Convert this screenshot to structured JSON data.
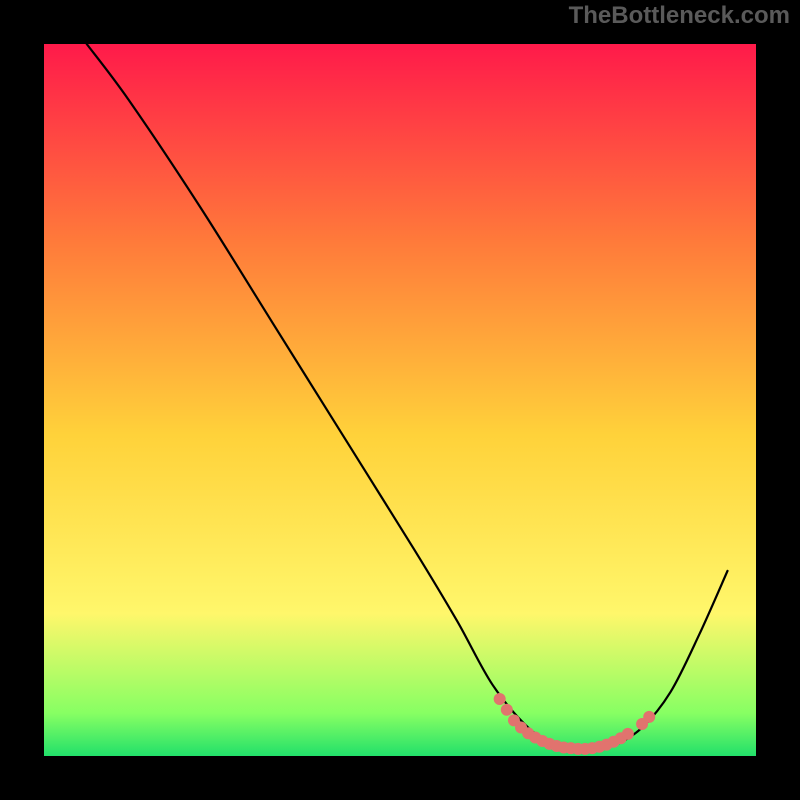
{
  "watermark": "TheBottleneck.com",
  "chart_data": {
    "type": "line",
    "title": "",
    "xlabel": "",
    "ylabel": "",
    "xlim": [
      0,
      100
    ],
    "ylim": [
      0,
      100
    ],
    "curve": [
      {
        "x": 6,
        "y": 100
      },
      {
        "x": 12,
        "y": 92
      },
      {
        "x": 22,
        "y": 77
      },
      {
        "x": 32,
        "y": 61
      },
      {
        "x": 42,
        "y": 45
      },
      {
        "x": 52,
        "y": 29
      },
      {
        "x": 58,
        "y": 19
      },
      {
        "x": 63,
        "y": 10
      },
      {
        "x": 68,
        "y": 4
      },
      {
        "x": 72,
        "y": 1.5
      },
      {
        "x": 76,
        "y": 1
      },
      {
        "x": 80,
        "y": 1.5
      },
      {
        "x": 84,
        "y": 4
      },
      {
        "x": 88,
        "y": 9
      },
      {
        "x": 92,
        "y": 17
      },
      {
        "x": 96,
        "y": 26
      }
    ],
    "highlight_points": [
      {
        "x": 64,
        "y": 8
      },
      {
        "x": 65,
        "y": 6.5
      },
      {
        "x": 66,
        "y": 5
      },
      {
        "x": 67,
        "y": 4
      },
      {
        "x": 68,
        "y": 3.2
      },
      {
        "x": 69,
        "y": 2.6
      },
      {
        "x": 70,
        "y": 2.1
      },
      {
        "x": 71,
        "y": 1.7
      },
      {
        "x": 72,
        "y": 1.4
      },
      {
        "x": 73,
        "y": 1.2
      },
      {
        "x": 74,
        "y": 1.1
      },
      {
        "x": 75,
        "y": 1.0
      },
      {
        "x": 76,
        "y": 1.0
      },
      {
        "x": 77,
        "y": 1.1
      },
      {
        "x": 78,
        "y": 1.3
      },
      {
        "x": 79,
        "y": 1.6
      },
      {
        "x": 80,
        "y": 2.0
      },
      {
        "x": 81,
        "y": 2.5
      },
      {
        "x": 82,
        "y": 3.1
      },
      {
        "x": 84,
        "y": 4.5
      },
      {
        "x": 85,
        "y": 5.5
      }
    ],
    "background_gradient": {
      "top": "#ff1a4a",
      "upper_mid": "#ff7b3a",
      "mid": "#ffd23a",
      "lower_mid": "#fff76b",
      "above_bottom": "#87ff63",
      "bottom": "#22e06a"
    },
    "frame_color": "#000000",
    "frame_width_pct": 5.5,
    "curve_color": "#000000",
    "highlight_color": "#e1736e"
  }
}
